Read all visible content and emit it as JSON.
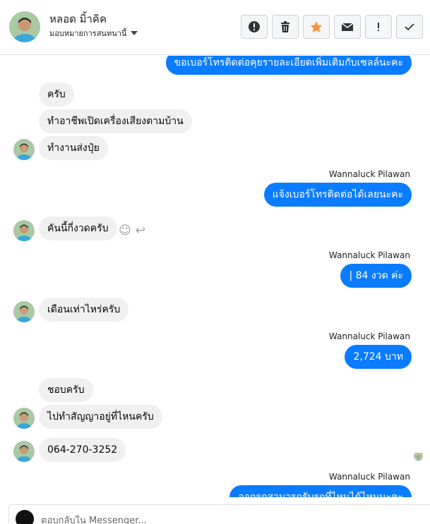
{
  "header": {
    "name": "หลอด มิ้าคิค",
    "status": "มอบหมายการสนทนานี้"
  },
  "actions": [
    {
      "icon": "alert-circle-icon"
    },
    {
      "icon": "trash-icon"
    },
    {
      "icon": "star-icon",
      "color": "#f7923a"
    },
    {
      "icon": "envelope-icon"
    },
    {
      "icon": "exclamation-icon"
    },
    {
      "icon": "check-icon"
    }
  ],
  "messages": {
    "out_top": "ขอเบอร์โทรติดต่อคุยรายละเอียดเพิ่มเติมกับเซลล์นะคะ",
    "in1": "ครับ",
    "in2": "ทำอาชีพเปิดเครื่องเสียงตามบ้าน",
    "in3": "ทำงานส่งปุ๋ย",
    "sender1": "Wannaluck Pilawan",
    "out2": "แจ้งเบอร์โทรติดต่อได้เลยนะคะ",
    "in4": "คันนี้กี่งวดครับ",
    "sender2": "Wannaluck Pilawan",
    "out3": "| 84 งวด ค่ะ",
    "in5": "เดือนเท่าไหร่ครับ",
    "sender3": "Wannaluck Pilawan",
    "out4": "2,724 บาท",
    "in6": "ชอบครับ",
    "in7": "ไปทำสัญญาอยู่ที่ไหนครับ",
    "in8": "064-270-3252",
    "sender4": "Wannaluck Pilawan",
    "out5": "ออกรถสามารถรับรถที่ไหนได้ไหมนะคะ"
  },
  "composer": {
    "placeholder": "ตอบกลับใน Messenger..."
  },
  "colors": {
    "accent": "#0a7cff",
    "incoming_bubble": "#f0f0f0"
  }
}
